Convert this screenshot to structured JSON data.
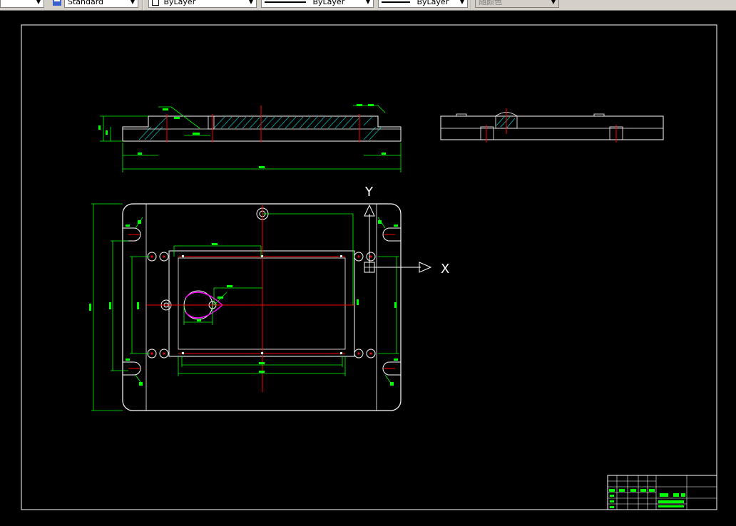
{
  "toolbar": {
    "style_value": "Standard",
    "layer_value": "ByLayer",
    "linetype_value": "ByLayer",
    "lineweight_value": "ByLayer",
    "color_value": "随颜色"
  },
  "icons": {
    "style": "text-style-icon",
    "layer": "layer-state-icon"
  },
  "drawing": {
    "axis_y": "Y",
    "axis_x": "X"
  },
  "colors": {
    "background": "#000000",
    "geometry": "#ffffff",
    "dimension": "#00ff00",
    "centerline": "#ff0000",
    "hatch": "#00c8c8",
    "highlight": "#ff00ff"
  }
}
